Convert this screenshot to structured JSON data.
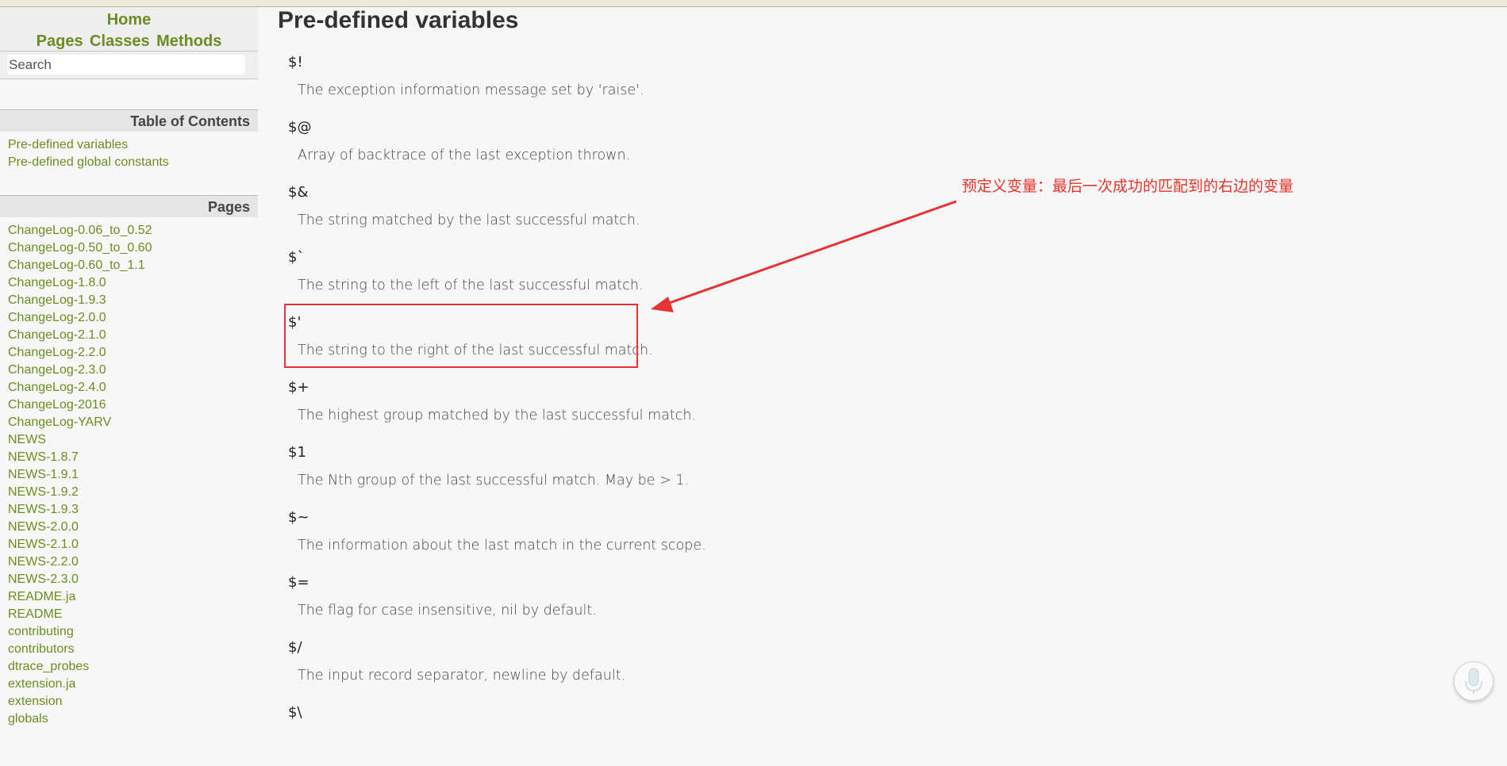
{
  "sidebar": {
    "home_link": "Home",
    "nav_links": [
      "Pages",
      "Classes",
      "Methods"
    ],
    "search_placeholder": "Search",
    "toc_heading": "Table of Contents",
    "toc_items": [
      "Pre-defined variables",
      "Pre-defined global constants"
    ],
    "pages_heading": "Pages",
    "pages": [
      "ChangeLog-0.06_to_0.52",
      "ChangeLog-0.50_to_0.60",
      "ChangeLog-0.60_to_1.1",
      "ChangeLog-1.8.0",
      "ChangeLog-1.9.3",
      "ChangeLog-2.0.0",
      "ChangeLog-2.1.0",
      "ChangeLog-2.2.0",
      "ChangeLog-2.3.0",
      "ChangeLog-2.4.0",
      "ChangeLog-2016",
      "ChangeLog-YARV",
      "NEWS",
      "NEWS-1.8.7",
      "NEWS-1.9.1",
      "NEWS-1.9.2",
      "NEWS-1.9.3",
      "NEWS-2.0.0",
      "NEWS-2.1.0",
      "NEWS-2.2.0",
      "NEWS-2.3.0",
      "README.ja",
      "README",
      "contributing",
      "contributors",
      "dtrace_probes",
      "extension.ja",
      "extension",
      "globals"
    ]
  },
  "main": {
    "title": "Pre-defined variables",
    "variables": [
      {
        "name": "$!",
        "desc": "The exception information message set by 'raise'."
      },
      {
        "name": "$@",
        "desc": "Array of backtrace of the last exception thrown."
      },
      {
        "name": "$&",
        "desc": "The string matched by the last successful match."
      },
      {
        "name": "$`",
        "desc": "The string to the left of the last successful match."
      },
      {
        "name": "$'",
        "desc": "The string to the right of the last successful match."
      },
      {
        "name": "$+",
        "desc": "The highest group matched by the last successful match."
      },
      {
        "name": "$1",
        "desc": "The Nth group of the last successful match. May be > 1."
      },
      {
        "name": "$~",
        "desc": "The information about the last match in the current scope."
      },
      {
        "name": "$=",
        "desc": "The flag for case insensitive, nil by default."
      },
      {
        "name": "$/",
        "desc": "The input record separator, newline by default."
      },
      {
        "name": "$\\",
        "desc": ""
      }
    ]
  },
  "annotation": {
    "text": "预定义变量：最后一次成功的匹配到的右边的变量",
    "color": "#e8322a"
  },
  "colors": {
    "link": "#6c8c22",
    "annotation": "#e53333"
  },
  "icons": {
    "mic": "microphone-icon"
  }
}
